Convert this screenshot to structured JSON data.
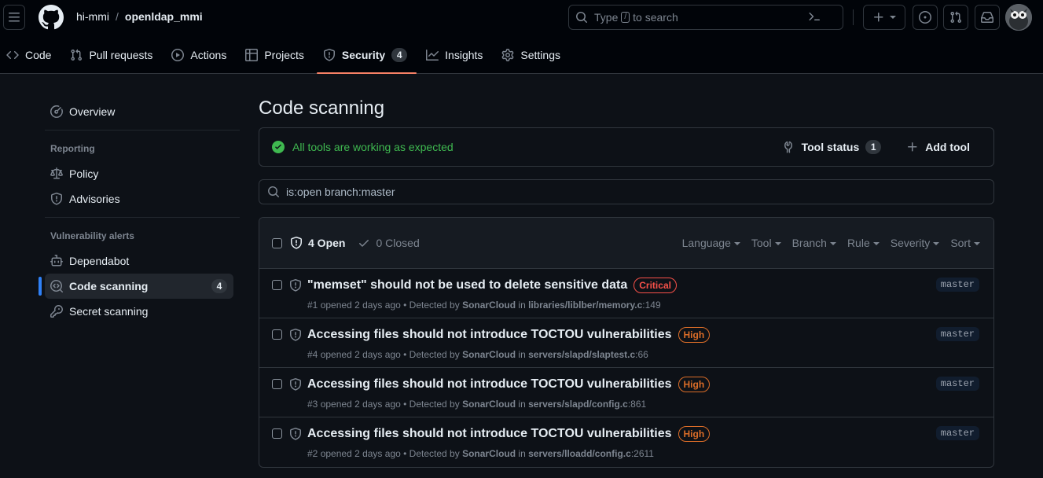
{
  "header": {
    "owner": "hi-mmi",
    "separator": "/",
    "repo": "openldap_mmi",
    "search_placeholder_prefix": "Type",
    "search_slash": "/",
    "search_placeholder_suffix": "to search"
  },
  "repo_nav": [
    {
      "label": "Code",
      "icon": "code-icon"
    },
    {
      "label": "Pull requests",
      "icon": "git-pull-request-icon"
    },
    {
      "label": "Actions",
      "icon": "play-icon"
    },
    {
      "label": "Projects",
      "icon": "table-icon"
    },
    {
      "label": "Security",
      "icon": "shield-icon",
      "count": "4",
      "active": true
    },
    {
      "label": "Insights",
      "icon": "graph-icon"
    },
    {
      "label": "Settings",
      "icon": "gear-icon"
    }
  ],
  "sidebar": {
    "overview": "Overview",
    "reporting_heading": "Reporting",
    "policy": "Policy",
    "advisories": "Advisories",
    "vuln_heading": "Vulnerability alerts",
    "dependabot": "Dependabot",
    "code_scanning": "Code scanning",
    "code_scanning_count": "4",
    "secret_scanning": "Secret scanning"
  },
  "main": {
    "title": "Code scanning",
    "status_text": "All tools are working as expected",
    "tool_status_label": "Tool status",
    "tool_status_count": "1",
    "add_tool_label": "Add tool",
    "filter_value": "is:open branch:master",
    "open_label": "4 Open",
    "closed_label": "0 Closed",
    "filters": [
      "Language",
      "Tool",
      "Branch",
      "Rule",
      "Severity",
      "Sort"
    ]
  },
  "alerts": [
    {
      "title": "\"memset\" should not be used to delete sensitive data",
      "severity": "Critical",
      "number": "#1",
      "opened": "opened 2 days ago",
      "detected_prefix": "• Detected by",
      "tool": "SonarCloud",
      "in": "in",
      "location": "libraries/liblber/memory.c",
      "line": ":149",
      "branch": "master"
    },
    {
      "title": "Accessing files should not introduce TOCTOU vulnerabilities",
      "severity": "High",
      "number": "#4",
      "opened": "opened 2 days ago",
      "detected_prefix": "• Detected by",
      "tool": "SonarCloud",
      "in": "in",
      "location": "servers/slapd/slaptest.c",
      "line": ":66",
      "branch": "master"
    },
    {
      "title": "Accessing files should not introduce TOCTOU vulnerabilities",
      "severity": "High",
      "number": "#3",
      "opened": "opened 2 days ago",
      "detected_prefix": "• Detected by",
      "tool": "SonarCloud",
      "in": "in",
      "location": "servers/slapd/config.c",
      "line": ":861",
      "branch": "master"
    },
    {
      "title": "Accessing files should not introduce TOCTOU vulnerabilities",
      "severity": "High",
      "number": "#2",
      "opened": "opened 2 days ago",
      "detected_prefix": "• Detected by",
      "tool": "SonarCloud",
      "in": "in",
      "location": "servers/lloadd/config.c",
      "line": ":2611",
      "branch": "master"
    }
  ]
}
